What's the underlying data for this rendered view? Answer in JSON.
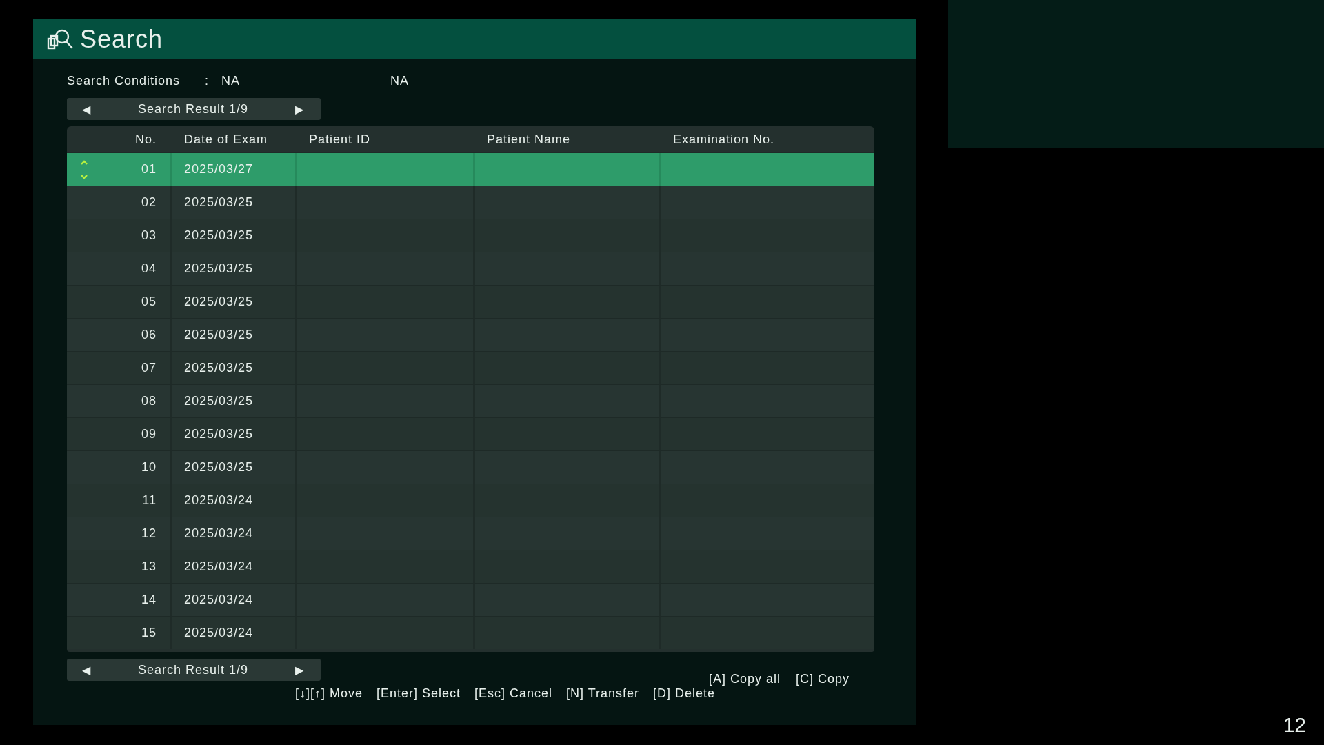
{
  "window": {
    "title": "Search"
  },
  "search_conditions": {
    "label": "Search Conditions",
    "separator": ":",
    "values": [
      "NA",
      "NA"
    ]
  },
  "pager_top": {
    "prev": "◀",
    "label": "Search Result 1/9",
    "next": "▶"
  },
  "table": {
    "columns": [
      "No.",
      "Date of Exam",
      "Patient ID",
      "Patient Name",
      "Examination No."
    ],
    "rows": [
      {
        "no": "01",
        "date": "2025/03/27",
        "selected": true
      },
      {
        "no": "02",
        "date": "2025/03/25",
        "selected": false
      },
      {
        "no": "03",
        "date": "2025/03/25",
        "selected": false
      },
      {
        "no": "04",
        "date": "2025/03/25",
        "selected": false
      },
      {
        "no": "05",
        "date": "2025/03/25",
        "selected": false
      },
      {
        "no": "06",
        "date": "2025/03/25",
        "selected": false
      },
      {
        "no": "07",
        "date": "2025/03/25",
        "selected": false
      },
      {
        "no": "08",
        "date": "2025/03/25",
        "selected": false
      },
      {
        "no": "09",
        "date": "2025/03/25",
        "selected": false
      },
      {
        "no": "10",
        "date": "2025/03/25",
        "selected": false
      },
      {
        "no": "11",
        "date": "2025/03/24",
        "selected": false
      },
      {
        "no": "12",
        "date": "2025/03/24",
        "selected": false
      },
      {
        "no": "13",
        "date": "2025/03/24",
        "selected": false
      },
      {
        "no": "14",
        "date": "2025/03/24",
        "selected": false
      },
      {
        "no": "15",
        "date": "2025/03/24",
        "selected": false
      }
    ]
  },
  "pager_bottom": {
    "prev": "◀",
    "label": "Search Result 1/9",
    "next": "▶"
  },
  "copy_hints": [
    "[A] Copy all",
    "[C] Copy"
  ],
  "key_hints": [
    "[↓][↑] Move",
    "[Enter] Select",
    "[Esc] Cancel",
    "[N] Transfer",
    "[D] Delete"
  ],
  "page_number": "12"
}
